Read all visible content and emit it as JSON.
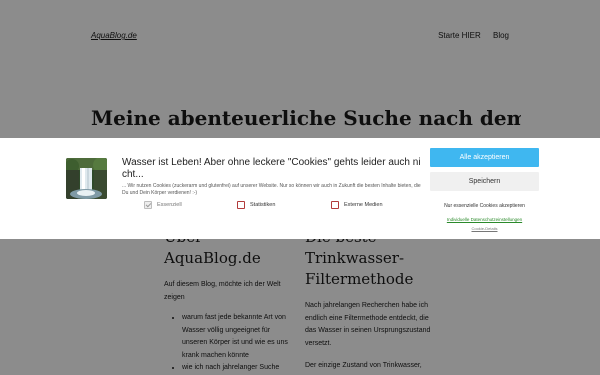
{
  "site": {
    "logo": "AquaBlog.de",
    "nav": [
      "Starte HIER",
      "Blog"
    ],
    "hero_title": "Meine abenteuerliche Suche nach dem besten",
    "left_col": {
      "heading_line1": "Über",
      "heading_line2": "AquaBlog.de",
      "intro": "Auf diesem Blog, möchte ich der Welt zeigen",
      "bullets": [
        "warum fast jede bekannte Art von Wasser völlig ungeeignet für unseren Körper ist und wie es uns krank machen könnte",
        "wie ich nach jahrelanger Suche"
      ]
    },
    "right_col": {
      "heading_line1": "Die beste",
      "heading_line2": "Trinkwasser-",
      "heading_line3": "Filtermethode",
      "para1": "Nach jahrelangen Recherchen habe ich endlich eine Filtermethode entdeckt, die das Wasser in seinen Ursprungszustand versetzt.",
      "para2": "Der einzige Zustand von Trinkwasser,"
    }
  },
  "consent": {
    "title": "Wasser ist Leben! Aber ohne leckere \"Cookies\" gehts leider auch ni cht...",
    "text": "... Wir nutzen Cookies (zuckerarm und glutenfrei) auf unserer Website. Nur so können wir auch in Zukunft die besten Inhalte bieten, die Du und Dein Körper verdienen! :-)",
    "checkboxes": [
      {
        "label": "Essenziell",
        "checked": true
      },
      {
        "label": "Statistiken",
        "checked": false
      },
      {
        "label": "Externe Medien",
        "checked": false
      }
    ],
    "accept_all": "Alle akzeptieren",
    "save": "Speichern",
    "essential_only": "Nur essenzielle Cookies akzeptieren",
    "settings_link": "Individuelle Datenschutzeinstellungen",
    "cookie_details": "Cookie-Details",
    "accent_color": "#3fb7f0",
    "image": "waterfall-photo"
  }
}
